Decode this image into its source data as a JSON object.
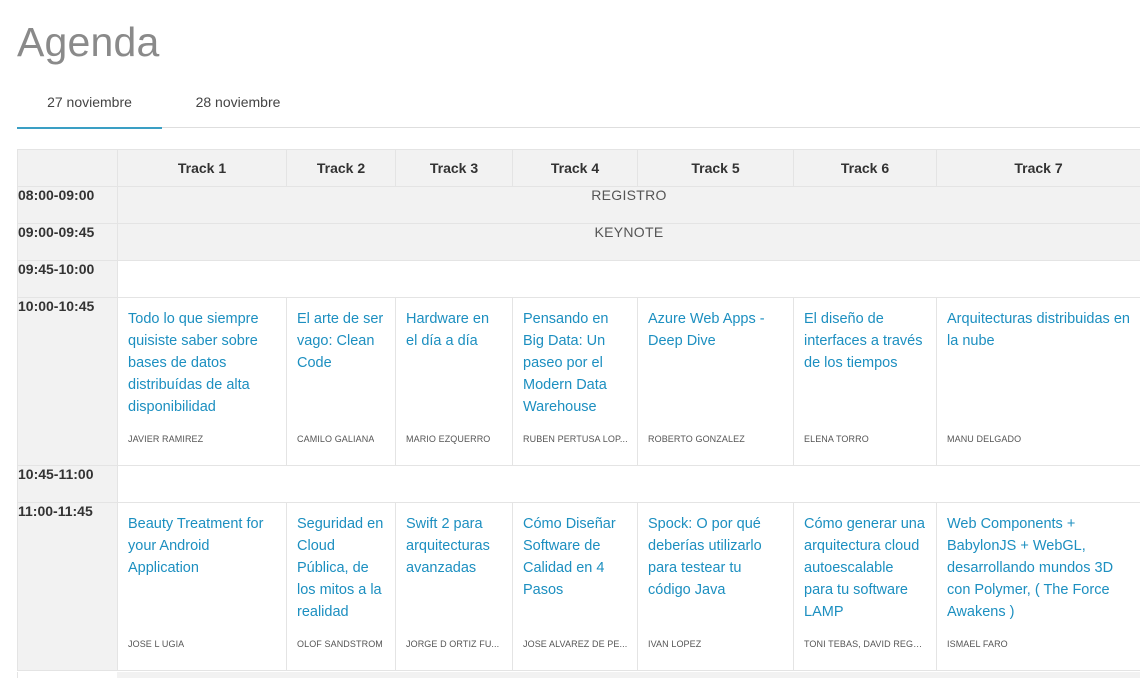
{
  "page": {
    "title": "Agenda"
  },
  "tabs": [
    {
      "label": "27 noviembre",
      "active": true
    },
    {
      "label": "28 noviembre",
      "active": false
    }
  ],
  "table": {
    "tracks": [
      "Track 1",
      "Track 2",
      "Track 3",
      "Track 4",
      "Track 5",
      "Track 6",
      "Track 7"
    ],
    "slots": [
      {
        "time": "08:00-09:00",
        "label": "REGISTRO"
      },
      {
        "time": "09:00-09:45",
        "label": "KEYNOTE"
      },
      {
        "time": "09:45-10:00"
      },
      {
        "time": "10:00-10:45",
        "talks": [
          {
            "title": "Todo lo que siempre quisiste saber sobre bases de datos distribuídas de alta disponibilidad",
            "speaker": "JAVIER RAMIREZ"
          },
          {
            "title": "El arte de ser vago: Clean Code",
            "speaker": "CAMILO GALIANA"
          },
          {
            "title": "Hardware en el día a día",
            "speaker": "MARIO EZQUERRO"
          },
          {
            "title": "Pensando en Big Data: Un paseo por el Modern Data Warehouse",
            "speaker": "RUBEN PERTUSA LOP..."
          },
          {
            "title": "Azure Web Apps - Deep Dive",
            "speaker": "ROBERTO GONZALEZ"
          },
          {
            "title": "El diseño de interfaces a través de los tiempos",
            "speaker": "ELENA TORRO"
          },
          {
            "title": "Arquitecturas distribuidas en la nube",
            "speaker": "MANU DELGADO"
          }
        ]
      },
      {
        "time": "10:45-11:00"
      },
      {
        "time": "11:00-11:45",
        "talks": [
          {
            "title": "Beauty Treatment for your Android Application",
            "speaker": "JOSE L UGIA"
          },
          {
            "title": "Seguridad en Cloud Pública, de los mitos a la realidad",
            "speaker": "OLOF SANDSTROM"
          },
          {
            "title": "Swift 2 para arquitecturas avanzadas",
            "speaker": "JORGE D ORTIZ FU..."
          },
          {
            "title": "Cómo Diseñar Software de Calidad en 4 Pasos",
            "speaker": "JOSE ALVAREZ DE PE..."
          },
          {
            "title": "Spock: O por qué deberías utilizarlo para testear tu código Java",
            "speaker": "IVAN LOPEZ"
          },
          {
            "title": "Cómo generar una arquitectura cloud autoescalable para tu software LAMP",
            "speaker": "TONI TEBAS, DAVID REGO..."
          },
          {
            "title": "Web Components + BabylonJS + WebGL, desarrollando mundos 3D con Polymer, ( The Force Awakens )",
            "speaker": "ISMAEL FARO"
          }
        ]
      }
    ]
  },
  "colors": {
    "accent": "#3a9fc4",
    "link": "#1c8fc0",
    "header_bg": "#f2f2f2",
    "border": "#e4e4e4"
  }
}
